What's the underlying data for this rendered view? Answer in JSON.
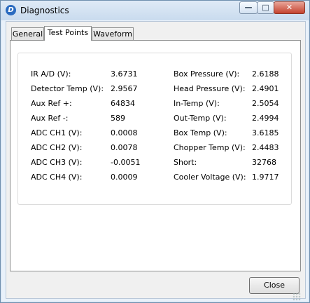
{
  "window": {
    "title": "Diagnostics",
    "app_icon_glyph": "D"
  },
  "controls": {
    "minimize": "—",
    "maximize": "□",
    "close": "✕"
  },
  "tabs": [
    {
      "label": "General",
      "selected": false
    },
    {
      "label": "Test Points",
      "selected": true
    },
    {
      "label": "Waveform",
      "selected": false
    }
  ],
  "test_points": {
    "left": [
      {
        "label": "IR A/D (V):",
        "value": "3.6731"
      },
      {
        "label": "Detector Temp (V):",
        "value": "2.9567"
      },
      {
        "label": "Aux Ref +:",
        "value": "64834"
      },
      {
        "label": "Aux Ref -:",
        "value": "589"
      },
      {
        "label": "ADC CH1 (V):",
        "value": "0.0008"
      },
      {
        "label": "ADC CH2 (V):",
        "value": "0.0078"
      },
      {
        "label": "ADC CH3 (V):",
        "value": "-0.0051"
      },
      {
        "label": "ADC CH4 (V):",
        "value": "0.0009"
      }
    ],
    "right": [
      {
        "label": "Box Pressure (V):",
        "value": "2.6188"
      },
      {
        "label": "Head Pressure (V):",
        "value": "2.4901"
      },
      {
        "label": "In-Temp (V):",
        "value": "2.5054"
      },
      {
        "label": "Out-Temp (V):",
        "value": "2.4994"
      },
      {
        "label": "Box Temp (V):",
        "value": "3.6185"
      },
      {
        "label": "Chopper Temp (V):",
        "value": "2.4483"
      },
      {
        "label": "Short:",
        "value": "32768"
      },
      {
        "label": "Cooler Voltage (V):",
        "value": "1.9717"
      }
    ]
  },
  "buttons": {
    "close": "Close"
  }
}
